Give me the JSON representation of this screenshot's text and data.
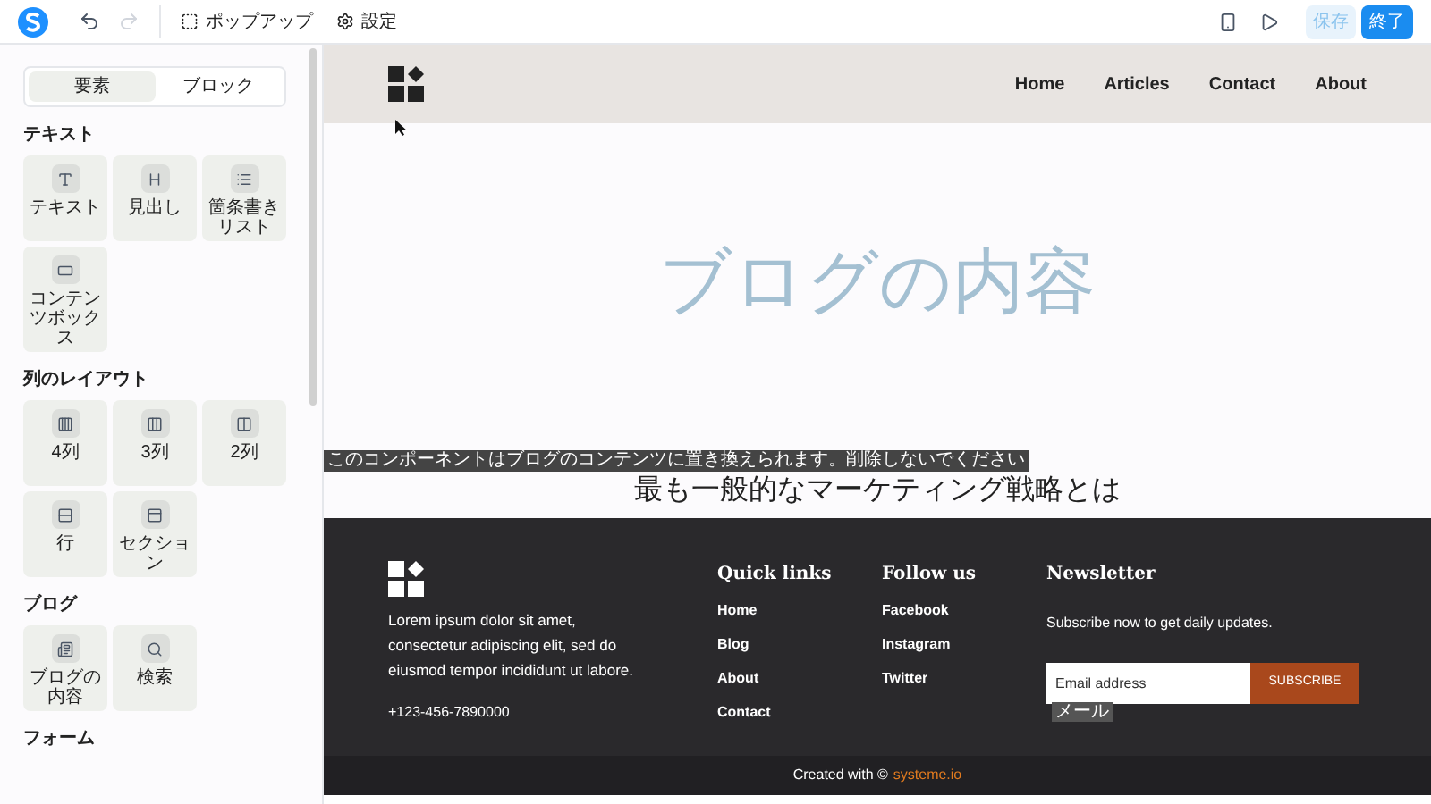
{
  "toolbar": {
    "items": [
      {
        "kind": "popup",
        "label": "ポップアップ"
      },
      {
        "kind": "settings",
        "label": "設定"
      }
    ],
    "save": "保存",
    "finish": "終了"
  },
  "sidebar": {
    "tabs": [
      {
        "label": "要素",
        "selected": true
      },
      {
        "label": "ブロック",
        "selected": false
      }
    ],
    "sections": [
      {
        "title": "テキスト",
        "items": [
          {
            "kind": "text",
            "label": "テキスト"
          },
          {
            "kind": "heading",
            "label": "見出し"
          },
          {
            "kind": "list",
            "label": "箇条書きリスト"
          },
          {
            "kind": "box",
            "label": "コンテンツボックス"
          }
        ]
      },
      {
        "title": "列のレイアウト",
        "items": [
          {
            "kind": "col4",
            "label": "4列"
          },
          {
            "kind": "col3",
            "label": "3列"
          },
          {
            "kind": "col2",
            "label": "2列"
          },
          {
            "kind": "row",
            "label": "行"
          },
          {
            "kind": "section",
            "label": "セクション"
          }
        ]
      },
      {
        "title": "ブログ",
        "items": [
          {
            "kind": "blog",
            "label": "ブログの内容"
          },
          {
            "kind": "search",
            "label": "検索"
          }
        ]
      },
      {
        "title": "フォーム"
      }
    ]
  },
  "site": {
    "nav": [
      "Home",
      "Articles",
      "Contact",
      "About"
    ],
    "hero": "ブログの内容",
    "tooltip": "このコンポーネントはブログのコンテンツに置き換えられます。削除しないでください",
    "heading": "最も一般的なマーケティング戦略とは",
    "footer": {
      "about": "Lorem ipsum dolor sit amet, consectetur adipiscing elit, sed do eiusmod tempor incididunt ut labore.",
      "phone": "+123-456-7890000",
      "columns": [
        {
          "title": "Quick links",
          "links": [
            "Home",
            "Blog",
            "About",
            "Contact"
          ]
        },
        {
          "title": "Follow us",
          "links": [
            "Facebook",
            "Instagram",
            "Twitter"
          ]
        }
      ],
      "newsletter": {
        "title": "Newsletter",
        "text": "Subscribe now to get daily updates.",
        "placeholder": "Email address",
        "field_tag": "メール",
        "button": "SUBSCRIBE"
      },
      "credit": "Created with ©",
      "brand": "systeme.io"
    }
  }
}
